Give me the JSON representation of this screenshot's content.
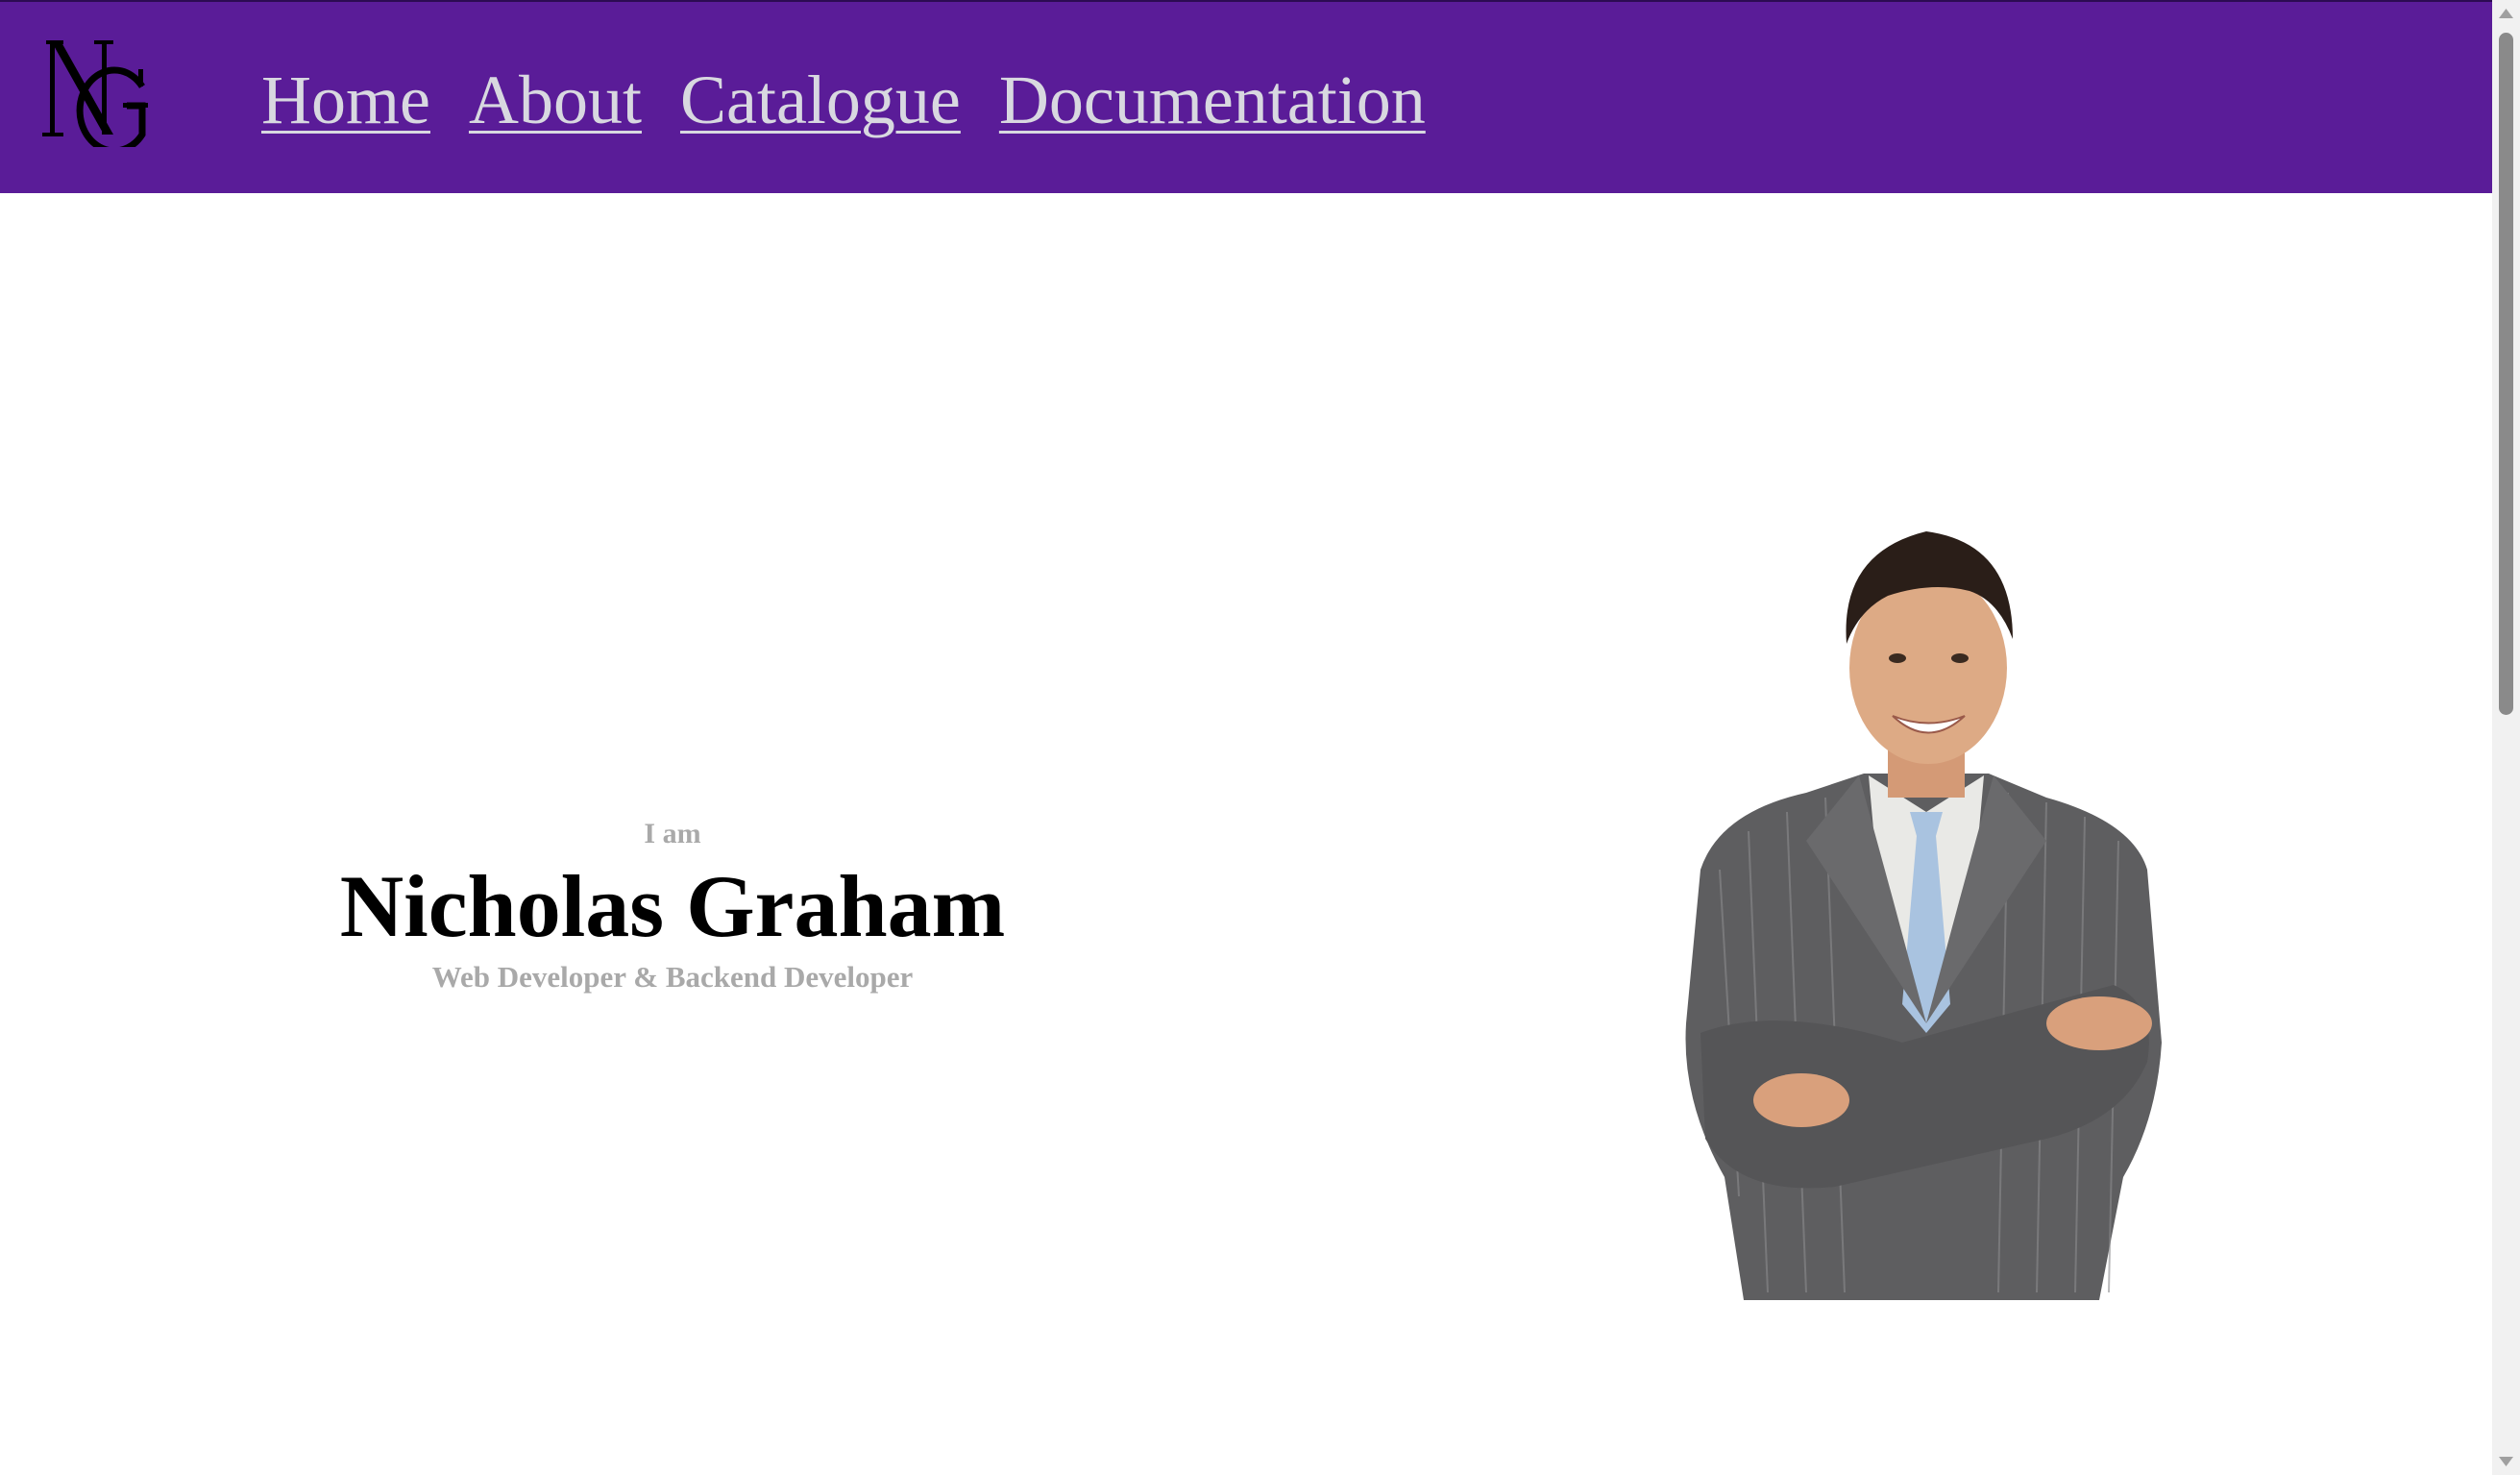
{
  "header": {
    "logo_icon": "ng-monogram-logo",
    "nav": [
      "Home",
      "About",
      "Catalogue",
      "Documentation"
    ],
    "colors": {
      "background": "#5a1c98",
      "link": "#d8d8e0"
    }
  },
  "hero": {
    "intro": "I am",
    "name": "Nicholas Graham",
    "role": "Web Developer & Backend Developer"
  },
  "portrait": {
    "icon": "person-in-suit-portrait"
  }
}
